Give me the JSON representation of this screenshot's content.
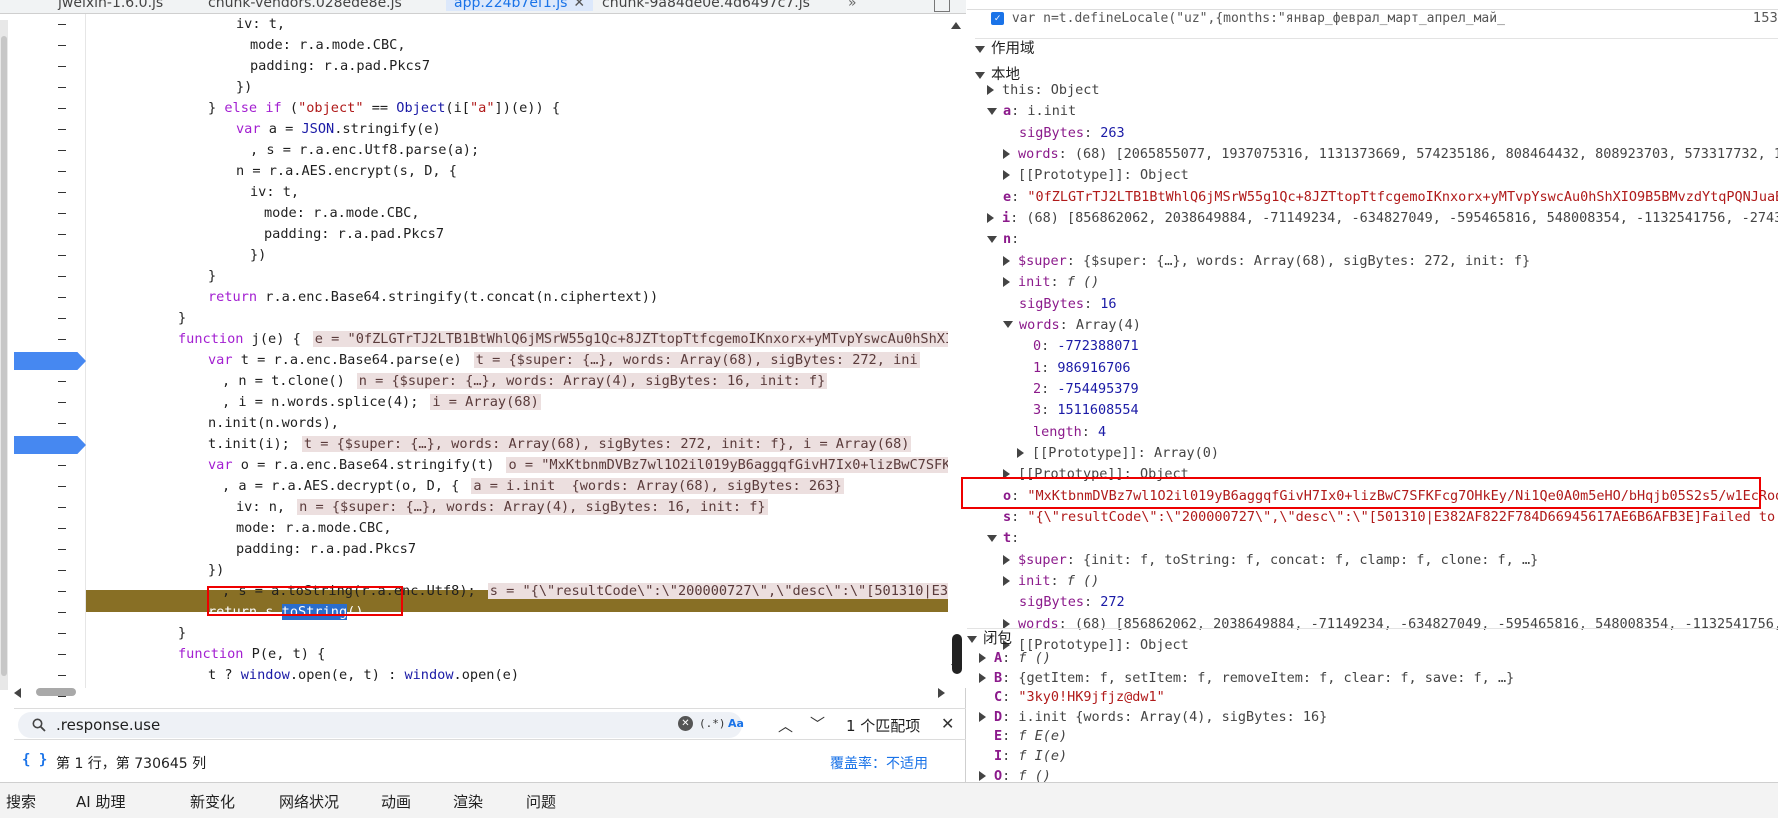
{
  "tabs": [
    {
      "label": "jweixin-1.6.0.js",
      "active": false
    },
    {
      "label": "chunk-vendors.028ede8e.js",
      "active": false
    },
    {
      "label": "app.224b7ef1.js",
      "active": true
    },
    {
      "label": "chunk-9a84de0e.4d6497c7.js",
      "active": false
    },
    {
      "label": "»",
      "active": false
    }
  ],
  "code_lines": [
    {
      "t": "iv: t,"
    },
    {
      "t": "mode: r.a.mode.CBC,"
    },
    {
      "t": "padding: r.a.pad.Pkcs7"
    },
    {
      "t": "})"
    },
    {
      "t": "} else if (\"object\" == Object(i[\"a\"])(e)) {"
    },
    {
      "t": "var a = JSON.stringify(e)"
    },
    {
      "t": ", s = r.a.enc.Utf8.parse(a);"
    },
    {
      "t": "n = r.a.AES.encrypt(s, D, {"
    },
    {
      "t": "iv: t,"
    },
    {
      "t": "mode: r.a.mode.CBC,"
    },
    {
      "t": "padding: r.a.pad.Pkcs7"
    },
    {
      "t": "})"
    },
    {
      "t": "}"
    },
    {
      "t": "return r.a.enc.Base64.stringify(t.concat(n.ciphertext))"
    },
    {
      "t": "}"
    },
    {
      "t": "function j(e) {",
      "inl": "e = \"0fZLGTrTJ2LTB1BtWhlQ6jMSrW55g1Qc+8JZTtopTtfcgemoIKnxorx+yMTvpYswcAu0hShXI"
    },
    {
      "t": "var t = r.a.enc.Base64.parse(e)",
      "inl": "t = {$super: {…}, words: Array(68), sigBytes: 272, ini"
    },
    {
      "t": ", n = t.clone()",
      "inl": "n = {$super: {…}, words: Array(4), sigBytes: 16, init: f}"
    },
    {
      "t": ", i = n.words.splice(4);",
      "inl": "i = Array(68)"
    },
    {
      "t": "n.init(n.words),"
    },
    {
      "t": "t.init(i);",
      "inl": "t = {$super: {…}, words: Array(68), sigBytes: 272, init: f}, i = Array(68)"
    },
    {
      "t": "var o = r.a.enc.Base64.stringify(t)",
      "inl": "o = \"MxKtbnmDVBz7wl1O2il019yB6aggqfGivH7Ix0+lizBwC7SFK"
    },
    {
      "t": ", a = r.a.AES.decrypt(o, D, {",
      "inl": "a = i.init  {words: Array(68), sigBytes: 263}"
    },
    {
      "t": "iv: n,",
      "inl": "n = {$super: {…}, words: Array(4), sigBytes: 16, init: f}"
    },
    {
      "t": "mode: r.a.mode.CBC,"
    },
    {
      "t": "padding: r.a.pad.Pkcs7"
    },
    {
      "t": "})"
    },
    {
      "t": ", s = a.toString(r.a.enc.Utf8);",
      "inl": "s = \"{\\\"resultCode\\\":\\\"200000727\\\",\\\"desc\\\":\\\"[501310|E3"
    },
    {
      "t": "return s.toString()"
    },
    {
      "t": "}"
    },
    {
      "t": "function P(e, t) {"
    },
    {
      "t": "t ? window.open(e, t) : window.open(e)"
    },
    {
      "t": "}"
    }
  ],
  "search": {
    "value": ".response.use",
    "match_count": "1 个匹配项",
    "case_label": "Aa",
    "regex_label": "(.*)"
  },
  "status": {
    "position": "第 1 行，第 730645 列",
    "coverage": "覆盖率：不适用",
    "brace": "{ }"
  },
  "bottom_tabs": [
    "搜索",
    "AI 助理",
    "新变化",
    "网络状况",
    "动画",
    "渲染",
    "问题"
  ],
  "right": {
    "top_line": "var n=t.defineLocale(\"uz\",{months:\"январ_феврал_март_апрел_май_",
    "top_count": "153",
    "scope_header": "作用域",
    "local_header": "本地",
    "closure_header": "闭包",
    "rows": [
      {
        "k": "this",
        "v": "Object",
        "type": "obj"
      },
      {
        "k": "a",
        "v": "i.init",
        "type": "expanded"
      },
      {
        "k": "sigBytes",
        "v": "263",
        "type": "num"
      },
      {
        "k": "words",
        "v": "(68)  [2065855077, 1937075316, 1131373669, 574235186, 808464432, 808923703, 573317732, 1",
        "type": "arr"
      },
      {
        "k": "[[Prototype]]",
        "v": "Object",
        "type": "obj"
      },
      {
        "k": "e",
        "v": "\"0fZLGTrTJ2LTB1BtWhlQ6jMSrW55g1Qc+8JZTtopTtfcgemoIKnxorx+yMTvpYswcAu0hShXIO9B5BMvzdYtqPQNJuaBz",
        "type": "str"
      },
      {
        "k": "i",
        "v": "(68)  [856862062, 2038649884, -71149234, -634827049, -595465816, 548008354, -1132541756, -2743",
        "type": "arr"
      },
      {
        "k": "n",
        "v": "",
        "type": "expanded"
      },
      {
        "k": "$super",
        "v": "{$super: {…}, words: Array(68), sigBytes: 272, init: f}",
        "type": "obj"
      },
      {
        "k": "init",
        "v": "f ()",
        "type": "fn"
      },
      {
        "k": "sigBytes",
        "v": "16",
        "type": "num"
      },
      {
        "k": "words",
        "v": "Array(4)",
        "type": "expanded"
      },
      {
        "k": "0",
        "v": "-772388071",
        "type": "num"
      },
      {
        "k": "1",
        "v": "986916706",
        "type": "num"
      },
      {
        "k": "2",
        "v": "-754495379",
        "type": "num"
      },
      {
        "k": "3",
        "v": "1511608554",
        "type": "num"
      },
      {
        "k": "length",
        "v": "4",
        "type": "num"
      },
      {
        "k": "[[Prototype]]",
        "v": "Array(0)",
        "type": "obj"
      },
      {
        "k": "[[Prototype]]",
        "v": "Object",
        "type": "obj"
      },
      {
        "k": "o",
        "v": "\"MxKtbnmDVBz7wl1O2il019yB6aggqfGivH7Ix0+lizBwC7SFKFcg7OHkEy/Ni1Qe0A0m5eHO/bHqjb05S2s5/w1EcRodN",
        "type": "str"
      },
      {
        "k": "s",
        "v": "\"{\\\"resultCode\\\":\\\"200000727\\\",\\\"desc\\\":\\\"[501310|E382AF822F784D66945617AE6B6AFB3E]Failed to i",
        "type": "str"
      },
      {
        "k": "t",
        "v": "",
        "type": "expanded"
      },
      {
        "k": "$super",
        "v": "{init: f, toString: f, concat: f, clamp: f, clone: f,  …}",
        "type": "obj"
      },
      {
        "k": "init",
        "v": "f ()",
        "type": "fn"
      },
      {
        "k": "sigBytes",
        "v": "272",
        "type": "num"
      },
      {
        "k": "words",
        "v": "(68)  [856862062, 2038649884, -71149234, -634827049, -595465816, 548008354, -1132541756, -27",
        "type": "arr"
      },
      {
        "k": "[[Prototype]]",
        "v": "Object",
        "type": "obj"
      }
    ],
    "closure_rows": [
      {
        "k": "A",
        "v": "f ()"
      },
      {
        "k": "B",
        "v": "{getItem: f, setItem: f, removeItem: f, clear: f, save: f,  …}"
      },
      {
        "k": "C",
        "v": "\"3ky0!HK9jfjz@dw1\""
      },
      {
        "k": "D",
        "v": "i.init  {words: Array(4), sigBytes: 16}"
      },
      {
        "k": "E",
        "v": "f E(e)"
      },
      {
        "k": "I",
        "v": "f I(e)"
      },
      {
        "k": "O",
        "v": "f ()"
      }
    ]
  }
}
